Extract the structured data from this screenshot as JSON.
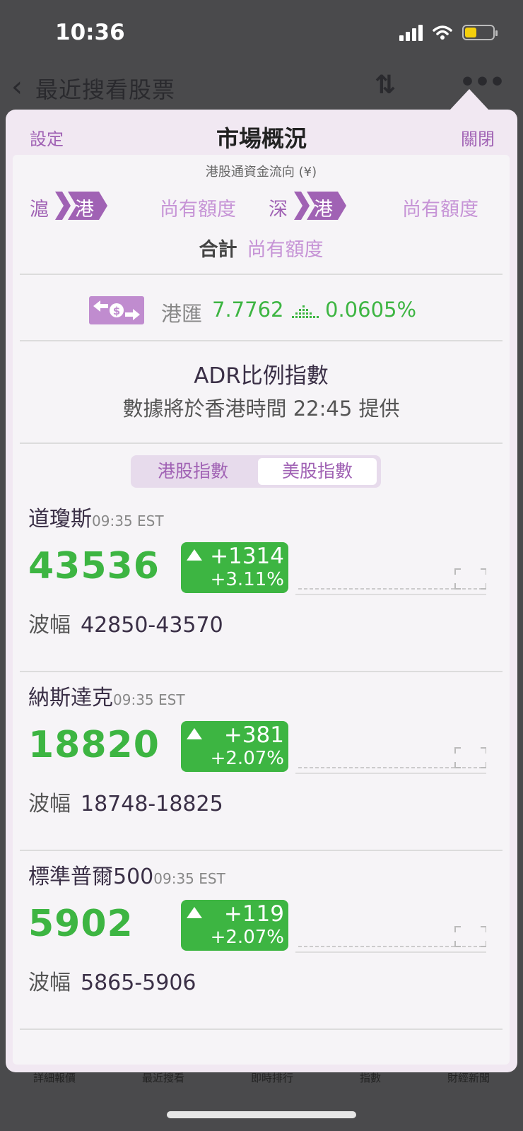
{
  "status": {
    "time": "10:36"
  },
  "background": {
    "title": "最近搜看股票",
    "tabs": [
      "詳細報價",
      "最近搜看",
      "即時排行",
      "指數",
      "財經新聞"
    ]
  },
  "popup": {
    "left_action": "設定",
    "title": "市場概況",
    "right_action": "關閉",
    "flow": {
      "title": "港股通資金流向 (¥)",
      "sh_src": "滬",
      "sh_dst": "港",
      "sh_quota": "尚有額度",
      "sz_src": "深",
      "sz_dst": "港",
      "sz_quota": "尚有額度",
      "total_label": "合計",
      "total_value": "尚有額度"
    },
    "fx": {
      "label": "港匯",
      "value": "7.7762",
      "change": "0.0605%"
    },
    "adr": {
      "title": "ADR比例指數",
      "subtitle": "數據將於香港時間 22:45 提供"
    },
    "tabs": {
      "hk": "港股指數",
      "us": "美股指數"
    },
    "indices": [
      {
        "name": "道瓊斯",
        "time": "09:35 EST",
        "price": "43536",
        "change": "+1314",
        "pct": "+3.11%",
        "range_label": "波幅",
        "range": "42850-43570"
      },
      {
        "name": "納斯達克",
        "time": "09:35 EST",
        "price": "18820",
        "change": "+381",
        "pct": "+2.07%",
        "range_label": "波幅",
        "range": "18748-18825"
      },
      {
        "name": "標準普爾500",
        "time": "09:35 EST",
        "price": "5902",
        "change": "+119",
        "pct": "+2.07%",
        "range_label": "波幅",
        "range": "5865-5906"
      }
    ],
    "colors": {
      "accent": "#a062b4",
      "up": "#3db542",
      "quota": "#c693d6"
    }
  }
}
